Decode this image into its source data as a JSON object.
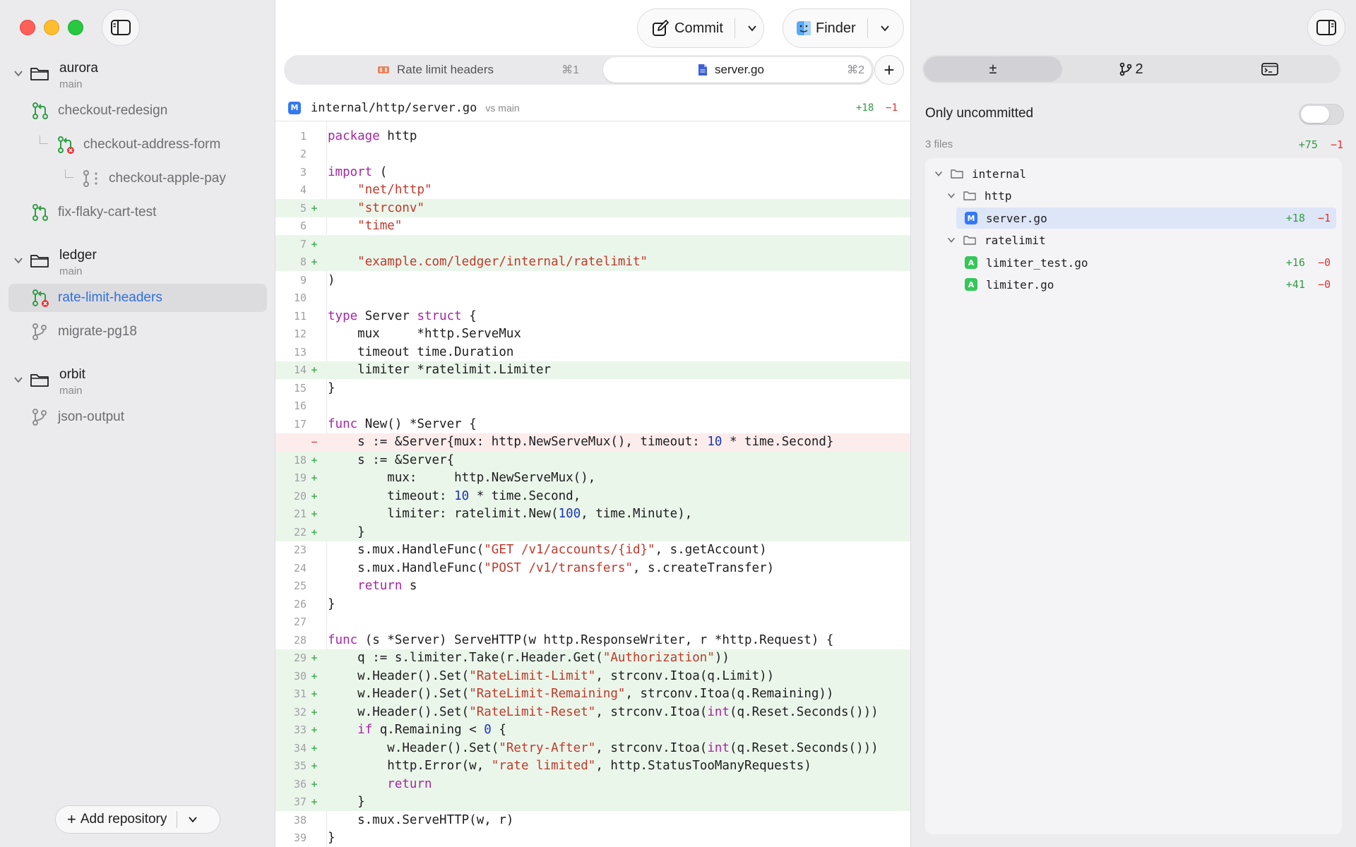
{
  "sidebar": {
    "repos": [
      {
        "name": "aurora",
        "branch": "main"
      },
      {
        "name": "ledger",
        "branch": "main"
      },
      {
        "name": "orbit",
        "branch": "main"
      }
    ],
    "branches": {
      "checkout_redesign": "checkout-redesign",
      "checkout_address_form": "checkout-address-form",
      "checkout_apple_pay": "checkout-apple-pay",
      "fix_flaky_cart_test": "fix-flaky-cart-test",
      "rate_limit_headers": "rate-limit-headers",
      "migrate_pg18": "migrate-pg18",
      "json_output": "json-output"
    },
    "add_repository": "Add repository"
  },
  "toolbar": {
    "commit_label": "Commit",
    "finder_label": "Finder"
  },
  "tabs": [
    {
      "label": "Rate limit headers",
      "shortcut": "⌘1"
    },
    {
      "label": "server.go",
      "shortcut": "⌘2"
    }
  ],
  "file": {
    "badge": "M",
    "path": "internal/http/server.go",
    "compare": "vs main",
    "added": "+18",
    "removed": "−1"
  },
  "code_lines": [
    {
      "n": "1",
      "t": " ",
      "h": "<span class='kw'>package</span> http"
    },
    {
      "n": "2",
      "t": " ",
      "h": ""
    },
    {
      "n": "3",
      "t": " ",
      "h": "<span class='kw'>import</span> ("
    },
    {
      "n": "4",
      "t": " ",
      "h": "    <span class='str'>\"net/http\"</span>"
    },
    {
      "n": "5",
      "t": "+",
      "h": "    <span class='str'>\"strconv\"</span>"
    },
    {
      "n": "6",
      "t": " ",
      "h": "    <span class='str'>\"time\"</span>"
    },
    {
      "n": "7",
      "t": "+",
      "h": ""
    },
    {
      "n": "8",
      "t": "+",
      "h": "    <span class='str'>\"example.com/ledger/internal/ratelimit\"</span>"
    },
    {
      "n": "9",
      "t": " ",
      "h": ")"
    },
    {
      "n": "10",
      "t": " ",
      "h": ""
    },
    {
      "n": "11",
      "t": " ",
      "h": "<span class='kw'>type</span> Server <span class='kw'>struct</span> {"
    },
    {
      "n": "12",
      "t": " ",
      "h": "    mux     *http.ServeMux"
    },
    {
      "n": "13",
      "t": " ",
      "h": "    timeout time.Duration"
    },
    {
      "n": "14",
      "t": "+",
      "h": "    limiter *ratelimit.Limiter"
    },
    {
      "n": "15",
      "t": " ",
      "h": "}"
    },
    {
      "n": "16",
      "t": " ",
      "h": ""
    },
    {
      "n": "17",
      "t": " ",
      "h": "<span class='kw'>func</span> New() *Server {"
    },
    {
      "n": "",
      "t": "−",
      "h": "    s := &amp;Server{mux: http.NewServeMux(), timeout: <span class='num'>10</span> * time.Second}"
    },
    {
      "n": "18",
      "t": "+",
      "h": "    s := &amp;Server{"
    },
    {
      "n": "19",
      "t": "+",
      "h": "        mux:     http.NewServeMux(),"
    },
    {
      "n": "20",
      "t": "+",
      "h": "        timeout: <span class='num'>10</span> * time.Second,"
    },
    {
      "n": "21",
      "t": "+",
      "h": "        limiter: ratelimit.New(<span class='num'>100</span>, time.Minute),"
    },
    {
      "n": "22",
      "t": "+",
      "h": "    }"
    },
    {
      "n": "23",
      "t": " ",
      "h": "    s.mux.HandleFunc(<span class='str'>\"GET /v1/accounts/{id}\"</span>, s.getAccount)"
    },
    {
      "n": "24",
      "t": " ",
      "h": "    s.mux.HandleFunc(<span class='str'>\"POST /v1/transfers\"</span>, s.createTransfer)"
    },
    {
      "n": "25",
      "t": " ",
      "h": "    <span class='kw'>return</span> s"
    },
    {
      "n": "26",
      "t": " ",
      "h": "}"
    },
    {
      "n": "27",
      "t": " ",
      "h": ""
    },
    {
      "n": "28",
      "t": " ",
      "h": "<span class='kw'>func</span> (s *Server) ServeHTTP(w http.ResponseWriter, r *http.Request) {"
    },
    {
      "n": "29",
      "t": "+",
      "h": "    q := s.limiter.Take(r.Header.Get(<span class='str'>\"Authorization\"</span>))"
    },
    {
      "n": "30",
      "t": "+",
      "h": "    w.Header().Set(<span class='str'>\"RateLimit-Limit\"</span>, strconv.Itoa(q.Limit))"
    },
    {
      "n": "31",
      "t": "+",
      "h": "    w.Header().Set(<span class='str'>\"RateLimit-Remaining\"</span>, strconv.Itoa(q.Remaining))"
    },
    {
      "n": "32",
      "t": "+",
      "h": "    w.Header().Set(<span class='str'>\"RateLimit-Reset\"</span>, strconv.Itoa(<span class='kw'>int</span>(q.Reset.Seconds()))"
    },
    {
      "n": "33",
      "t": "+",
      "h": "    <span class='kw'>if</span> q.Remaining &lt; <span class='num'>0</span> {"
    },
    {
      "n": "34",
      "t": "+",
      "h": "        w.Header().Set(<span class='str'>\"Retry-After\"</span>, strconv.Itoa(<span class='kw'>int</span>(q.Reset.Seconds()))"
    },
    {
      "n": "35",
      "t": "+",
      "h": "        http.Error(w, <span class='str'>\"rate limited\"</span>, http.StatusTooManyRequests)"
    },
    {
      "n": "36",
      "t": "+",
      "h": "        <span class='kw'>return</span>"
    },
    {
      "n": "37",
      "t": "+",
      "h": "    }"
    },
    {
      "n": "38",
      "t": " ",
      "h": "    s.mux.ServeHTTP(w, r)"
    },
    {
      "n": "39",
      "t": " ",
      "h": "}"
    }
  ],
  "rpanel": {
    "seg_diff": "±",
    "seg_branches": "2",
    "only_uncommitted": "Only uncommitted",
    "files_count": "3 files",
    "total_added": "+75",
    "total_removed": "−1",
    "tree": {
      "internal": "internal",
      "http": "http",
      "server_go": {
        "badge": "M",
        "name": "server.go",
        "added": "+18",
        "removed": "−1"
      },
      "ratelimit": "ratelimit",
      "limiter_test_go": {
        "badge": "A",
        "name": "limiter_test.go",
        "added": "+16",
        "removed": "−0"
      },
      "limiter_go": {
        "badge": "A",
        "name": "limiter.go",
        "added": "+41",
        "removed": "−0"
      }
    }
  }
}
